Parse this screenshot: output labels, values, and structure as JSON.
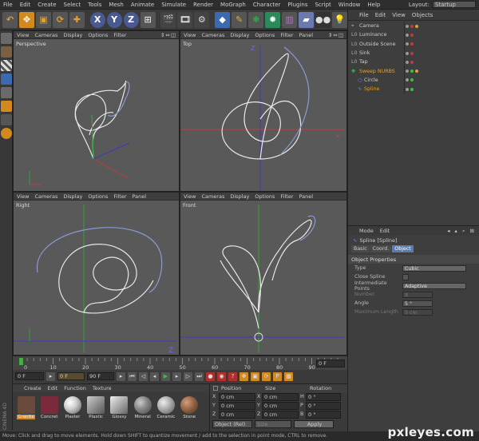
{
  "menu": [
    "File",
    "Edit",
    "Create",
    "Select",
    "Tools",
    "Mesh",
    "Animate",
    "Simulate",
    "Render",
    "MoGraph",
    "Character",
    "Plugins",
    "Script",
    "Window",
    "Help"
  ],
  "layout": {
    "label": "Layout:",
    "value": "Startup"
  },
  "viewport_menu": [
    "View",
    "Cameras",
    "Display",
    "Options",
    "Filter",
    "Panel"
  ],
  "viewports": {
    "perspective": "Perspective",
    "top": "Top",
    "right": "Right",
    "front": "Front"
  },
  "axis": {
    "z": "Z"
  },
  "timeline": {
    "ticks": [
      "0",
      "10",
      "20",
      "30",
      "40",
      "50",
      "60",
      "70",
      "80",
      "90"
    ],
    "end_field": "0 F"
  },
  "transport": {
    "start": "0 F",
    "current": "0 F",
    "end": "90 F"
  },
  "material_menu": [
    "Create",
    "Edit",
    "Function",
    "Texture"
  ],
  "materials": [
    {
      "name": "Granite",
      "color": "#6a4a3a"
    },
    {
      "name": "Concret",
      "color": "#7a2a3a"
    },
    {
      "name": "Plaster",
      "color": "#cfcfcf"
    },
    {
      "name": "Plastic",
      "color": "#9a9a9a"
    },
    {
      "name": "Glossy",
      "color": "#d8d8d8"
    },
    {
      "name": "Mineral",
      "color": "#8a8a8a"
    },
    {
      "name": "Ceramic",
      "color": "#b0b0b0"
    },
    {
      "name": "Stone",
      "color": "#9a6a4a"
    }
  ],
  "coords": {
    "headers": [
      "Position",
      "Size",
      "Rotation"
    ],
    "rows": [
      {
        "axis": "X",
        "pos": "0 cm",
        "size": "0 cm",
        "rot_axis": "H",
        "rot": "0 °"
      },
      {
        "axis": "Y",
        "pos": "0 cm",
        "size": "0 cm",
        "rot_axis": "P",
        "rot": "0 °"
      },
      {
        "axis": "Z",
        "pos": "0 cm",
        "size": "0 cm",
        "rot_axis": "B",
        "rot": "0 °"
      }
    ],
    "mode": "Object (Rel)",
    "size_mode": "Size",
    "apply": "Apply"
  },
  "object_menu": [
    "File",
    "Edit",
    "View",
    "Objects"
  ],
  "objects": [
    {
      "name": "Camera",
      "active": false
    },
    {
      "name": "Luminance",
      "active": false
    },
    {
      "name": "Outside Scene",
      "active": false
    },
    {
      "name": "Sink",
      "active": false
    },
    {
      "name": "Tap",
      "active": false
    },
    {
      "name": "Sweep NURBS",
      "active": true
    },
    {
      "name": "Circle",
      "active": false
    },
    {
      "name": "Spline",
      "active": true
    }
  ],
  "attr_menu": [
    "Mode",
    "Edit"
  ],
  "attr_title": "Spline [Spline]",
  "attr_tabs": [
    "Basic",
    "Coord.",
    "Object"
  ],
  "attr_section": "Object Properties",
  "attr_rows": [
    {
      "label": "Type",
      "value": "Cubic"
    },
    {
      "label": "Close Spline",
      "value": ""
    },
    {
      "label": "Intermediate Points",
      "value": "Adaptive"
    },
    {
      "label": "Number",
      "value": "8"
    },
    {
      "label": "Angle",
      "value": "5 °"
    },
    {
      "label": "Maximum Length",
      "value": "5 cm"
    }
  ],
  "status": "Move: Click and drag to move elements. Hold down SHIFT to quantize movement / add to the selection in point mode, CTRL to remove.",
  "brand": "CINEMA 4D",
  "watermark": "pxleyes.com"
}
